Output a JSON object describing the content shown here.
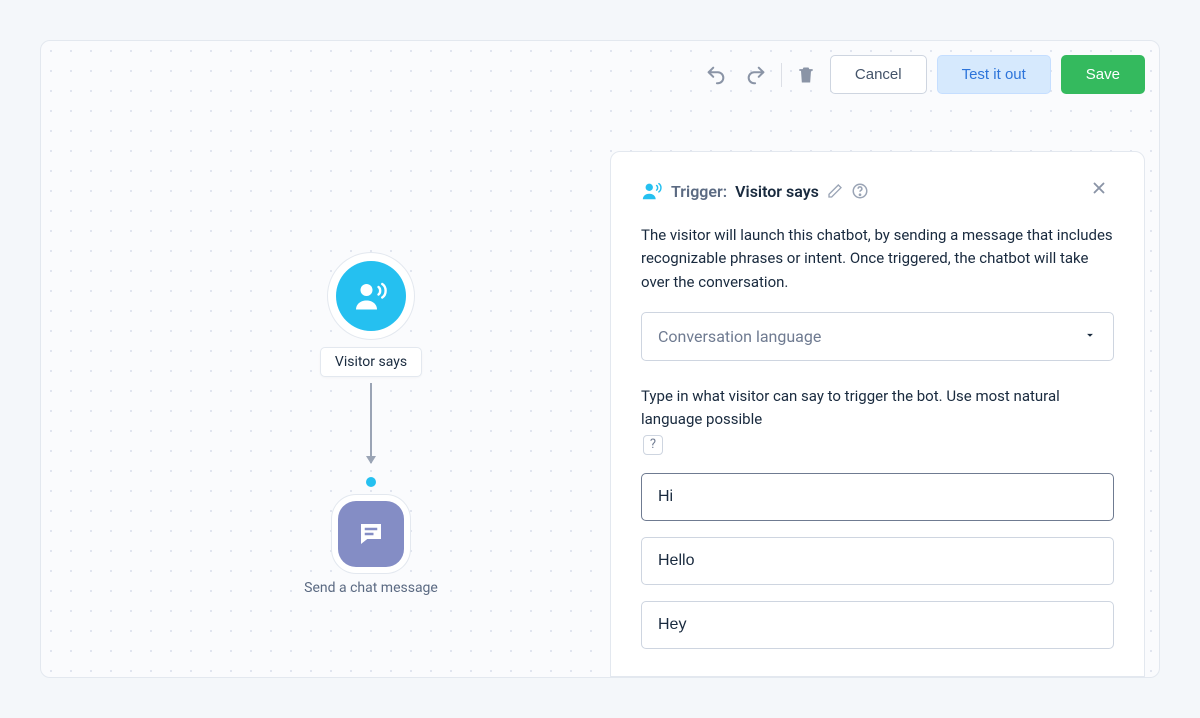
{
  "toolbar": {
    "cancel_label": "Cancel",
    "test_label": "Test it out",
    "save_label": "Save"
  },
  "flow": {
    "trigger_label": "Visitor says",
    "action_label": "Send a chat message"
  },
  "panel": {
    "title_prefix": "Trigger:",
    "title_name": "Visitor says",
    "description": "The visitor will launch this chatbot, by sending a message that includes recognizable phrases or intent. Once triggered, the chatbot will take over the conversation.",
    "language_select_label": "Conversation language",
    "instruction_text": "Type in what visitor can say to trigger the bot. Use most natural language possible",
    "help_symbol": "?",
    "phrases": [
      "Hi",
      "Hello",
      "Hey"
    ]
  }
}
